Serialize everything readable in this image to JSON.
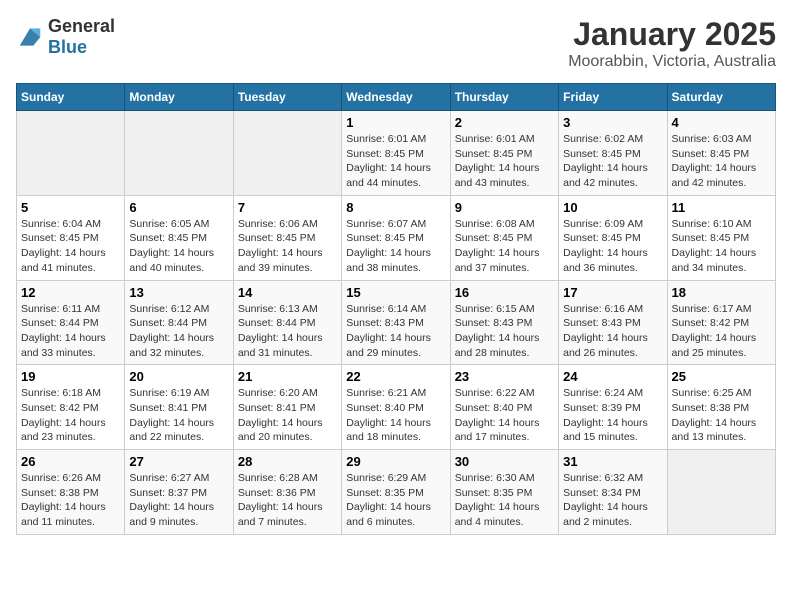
{
  "header": {
    "logo": {
      "text_general": "General",
      "text_blue": "Blue"
    },
    "title": "January 2025",
    "subtitle": "Moorabbin, Victoria, Australia"
  },
  "calendar": {
    "weekdays": [
      "Sunday",
      "Monday",
      "Tuesday",
      "Wednesday",
      "Thursday",
      "Friday",
      "Saturday"
    ],
    "weeks": [
      [
        {
          "day": "",
          "empty": true
        },
        {
          "day": "",
          "empty": true
        },
        {
          "day": "",
          "empty": true
        },
        {
          "day": "1",
          "sunrise": "6:01 AM",
          "sunset": "8:45 PM",
          "daylight": "14 hours and 44 minutes."
        },
        {
          "day": "2",
          "sunrise": "6:01 AM",
          "sunset": "8:45 PM",
          "daylight": "14 hours and 43 minutes."
        },
        {
          "day": "3",
          "sunrise": "6:02 AM",
          "sunset": "8:45 PM",
          "daylight": "14 hours and 42 minutes."
        },
        {
          "day": "4",
          "sunrise": "6:03 AM",
          "sunset": "8:45 PM",
          "daylight": "14 hours and 42 minutes."
        }
      ],
      [
        {
          "day": "5",
          "sunrise": "6:04 AM",
          "sunset": "8:45 PM",
          "daylight": "14 hours and 41 minutes."
        },
        {
          "day": "6",
          "sunrise": "6:05 AM",
          "sunset": "8:45 PM",
          "daylight": "14 hours and 40 minutes."
        },
        {
          "day": "7",
          "sunrise": "6:06 AM",
          "sunset": "8:45 PM",
          "daylight": "14 hours and 39 minutes."
        },
        {
          "day": "8",
          "sunrise": "6:07 AM",
          "sunset": "8:45 PM",
          "daylight": "14 hours and 38 minutes."
        },
        {
          "day": "9",
          "sunrise": "6:08 AM",
          "sunset": "8:45 PM",
          "daylight": "14 hours and 37 minutes."
        },
        {
          "day": "10",
          "sunrise": "6:09 AM",
          "sunset": "8:45 PM",
          "daylight": "14 hours and 36 minutes."
        },
        {
          "day": "11",
          "sunrise": "6:10 AM",
          "sunset": "8:45 PM",
          "daylight": "14 hours and 34 minutes."
        }
      ],
      [
        {
          "day": "12",
          "sunrise": "6:11 AM",
          "sunset": "8:44 PM",
          "daylight": "14 hours and 33 minutes."
        },
        {
          "day": "13",
          "sunrise": "6:12 AM",
          "sunset": "8:44 PM",
          "daylight": "14 hours and 32 minutes."
        },
        {
          "day": "14",
          "sunrise": "6:13 AM",
          "sunset": "8:44 PM",
          "daylight": "14 hours and 31 minutes."
        },
        {
          "day": "15",
          "sunrise": "6:14 AM",
          "sunset": "8:43 PM",
          "daylight": "14 hours and 29 minutes."
        },
        {
          "day": "16",
          "sunrise": "6:15 AM",
          "sunset": "8:43 PM",
          "daylight": "14 hours and 28 minutes."
        },
        {
          "day": "17",
          "sunrise": "6:16 AM",
          "sunset": "8:43 PM",
          "daylight": "14 hours and 26 minutes."
        },
        {
          "day": "18",
          "sunrise": "6:17 AM",
          "sunset": "8:42 PM",
          "daylight": "14 hours and 25 minutes."
        }
      ],
      [
        {
          "day": "19",
          "sunrise": "6:18 AM",
          "sunset": "8:42 PM",
          "daylight": "14 hours and 23 minutes."
        },
        {
          "day": "20",
          "sunrise": "6:19 AM",
          "sunset": "8:41 PM",
          "daylight": "14 hours and 22 minutes."
        },
        {
          "day": "21",
          "sunrise": "6:20 AM",
          "sunset": "8:41 PM",
          "daylight": "14 hours and 20 minutes."
        },
        {
          "day": "22",
          "sunrise": "6:21 AM",
          "sunset": "8:40 PM",
          "daylight": "14 hours and 18 minutes."
        },
        {
          "day": "23",
          "sunrise": "6:22 AM",
          "sunset": "8:40 PM",
          "daylight": "14 hours and 17 minutes."
        },
        {
          "day": "24",
          "sunrise": "6:24 AM",
          "sunset": "8:39 PM",
          "daylight": "14 hours and 15 minutes."
        },
        {
          "day": "25",
          "sunrise": "6:25 AM",
          "sunset": "8:38 PM",
          "daylight": "14 hours and 13 minutes."
        }
      ],
      [
        {
          "day": "26",
          "sunrise": "6:26 AM",
          "sunset": "8:38 PM",
          "daylight": "14 hours and 11 minutes."
        },
        {
          "day": "27",
          "sunrise": "6:27 AM",
          "sunset": "8:37 PM",
          "daylight": "14 hours and 9 minutes."
        },
        {
          "day": "28",
          "sunrise": "6:28 AM",
          "sunset": "8:36 PM",
          "daylight": "14 hours and 7 minutes."
        },
        {
          "day": "29",
          "sunrise": "6:29 AM",
          "sunset": "8:35 PM",
          "daylight": "14 hours and 6 minutes."
        },
        {
          "day": "30",
          "sunrise": "6:30 AM",
          "sunset": "8:35 PM",
          "daylight": "14 hours and 4 minutes."
        },
        {
          "day": "31",
          "sunrise": "6:32 AM",
          "sunset": "8:34 PM",
          "daylight": "14 hours and 2 minutes."
        },
        {
          "day": "",
          "empty": true
        }
      ]
    ],
    "labels": {
      "sunrise": "Sunrise:",
      "sunset": "Sunset:",
      "daylight": "Daylight:"
    }
  }
}
